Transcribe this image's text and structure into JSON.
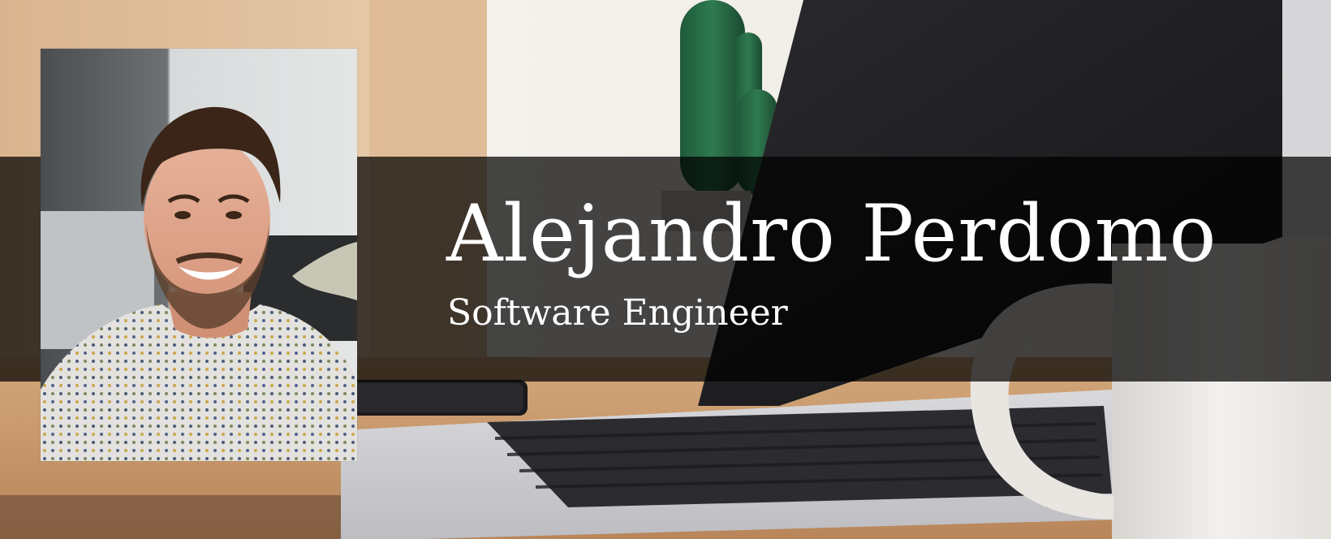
{
  "profile": {
    "name": "Alejandro Perdomo",
    "title": "Software Engineer"
  },
  "images": {
    "background": "laptop-desk-cactus-mug-photo",
    "portrait": "smiling-man-portrait-photo"
  },
  "colors": {
    "band": "#1a1a1a",
    "text": "#ffffff",
    "wall": "#f2efea",
    "wood": "#c99a6b"
  }
}
